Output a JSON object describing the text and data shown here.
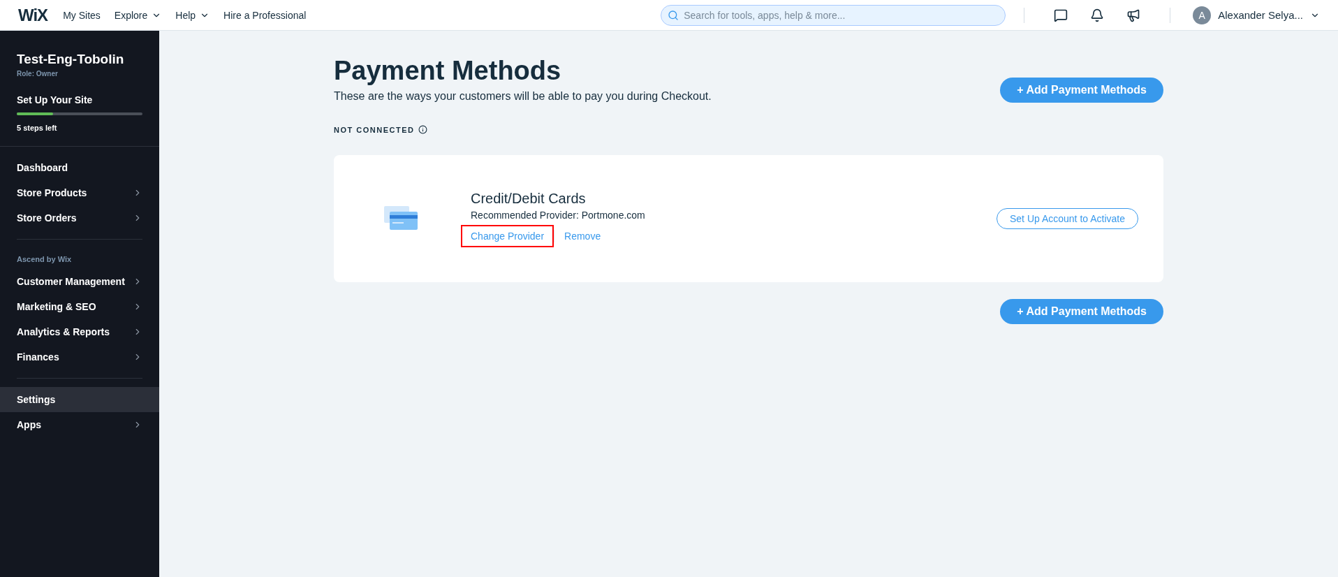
{
  "topbar": {
    "logo": "WiX",
    "nav": [
      {
        "label": "My Sites",
        "dropdown": false
      },
      {
        "label": "Explore",
        "dropdown": true
      },
      {
        "label": "Help",
        "dropdown": true
      },
      {
        "label": "Hire a Professional",
        "dropdown": false
      }
    ],
    "search": {
      "placeholder": "Search for tools, apps, help & more..."
    },
    "user": {
      "initial": "A",
      "name": "Alexander Selya..."
    }
  },
  "sidebar": {
    "site_name": "Test-Eng-Tobolin",
    "role": "Role: Owner",
    "setup": {
      "title": "Set Up Your Site",
      "level": 0.29,
      "steps_left": "5 steps left"
    },
    "groups": [
      {
        "items": [
          {
            "label": "Dashboard",
            "arrow": false,
            "selected": false
          },
          {
            "label": "Store Products",
            "arrow": true,
            "selected": false
          },
          {
            "label": "Store Orders",
            "arrow": true,
            "selected": false
          }
        ]
      },
      {
        "heading": "Ascend by Wix",
        "items": [
          {
            "label": "Customer Management",
            "arrow": true,
            "selected": false
          },
          {
            "label": "Marketing & SEO",
            "arrow": true,
            "selected": false
          },
          {
            "label": "Analytics & Reports",
            "arrow": true,
            "selected": false
          },
          {
            "label": "Finances",
            "arrow": true,
            "selected": false
          }
        ]
      },
      {
        "items": [
          {
            "label": "Settings",
            "arrow": false,
            "selected": true
          },
          {
            "label": "Apps",
            "arrow": true,
            "selected": false
          }
        ]
      }
    ]
  },
  "page": {
    "title": "Payment Methods",
    "subtitle": "These are the ways your customers will be able to pay you during Checkout.",
    "add_button": "+ Add Payment Methods",
    "section": "NOT CONNECTED",
    "methods": [
      {
        "name": "Credit/Debit Cards",
        "provider_label": "Recommended Provider:",
        "provider": "Portmone.com",
        "links": [
          {
            "label": "Change Provider",
            "highlighted": true
          },
          {
            "label": "Remove",
            "highlighted": false
          }
        ],
        "action": "Set Up Account to Activate"
      }
    ],
    "bottom_button": "+ Add Payment Methods"
  }
}
